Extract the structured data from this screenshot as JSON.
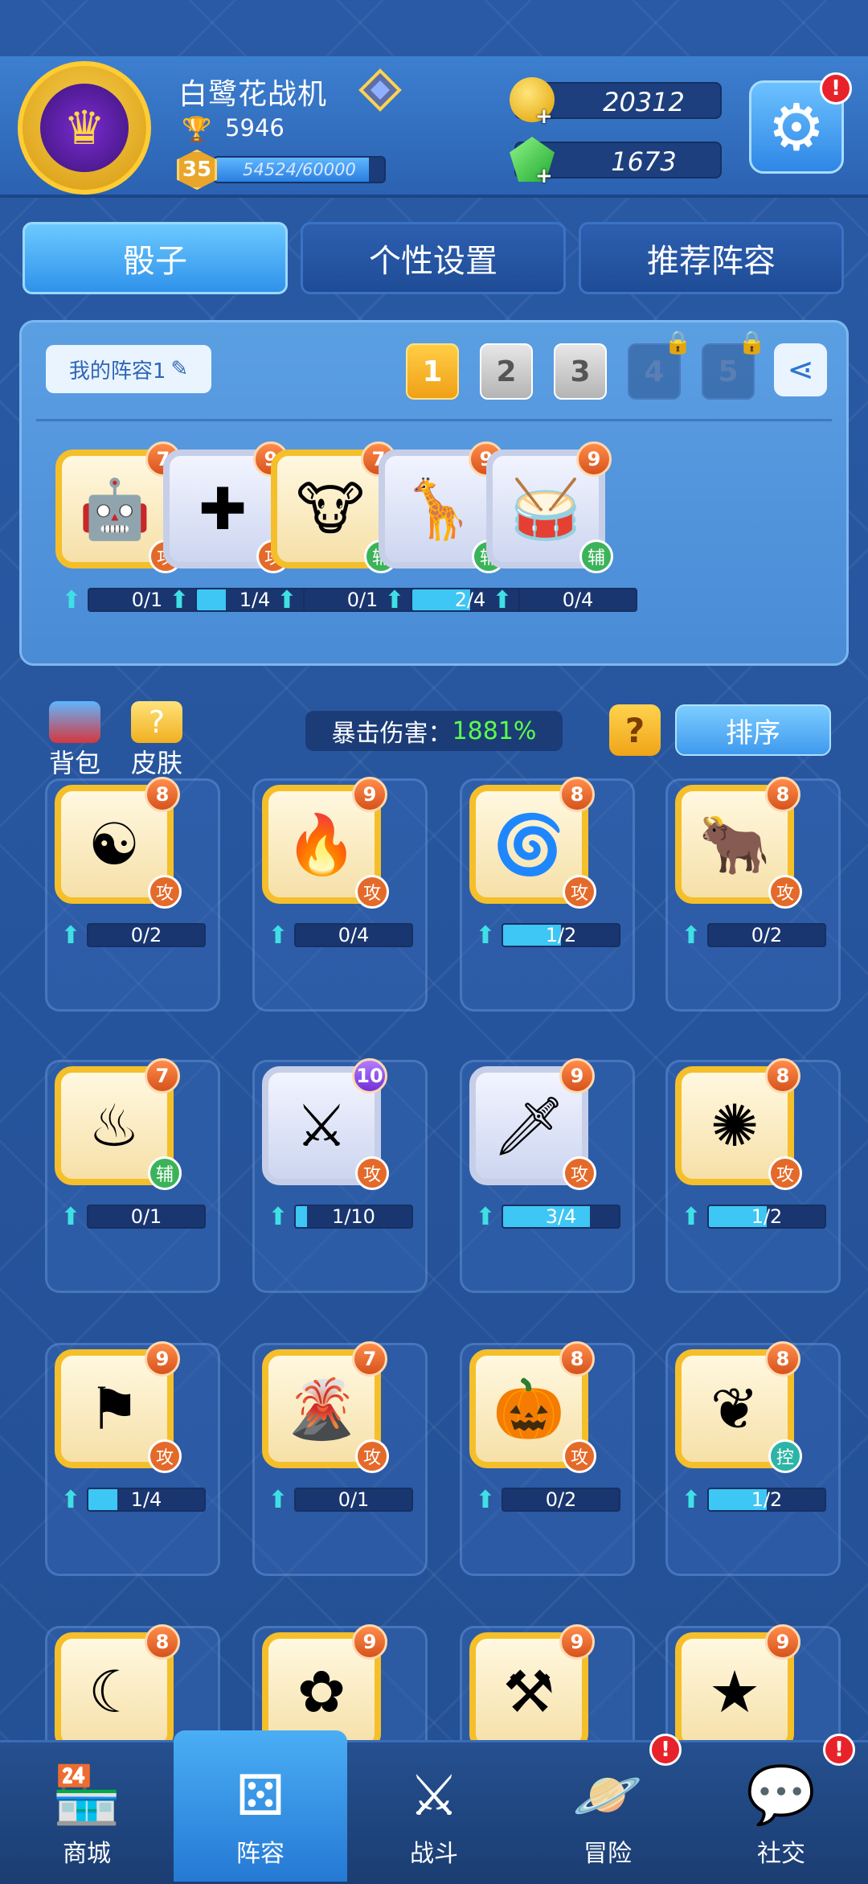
{
  "player": {
    "name": "白鹭花战机",
    "trophies": "5946",
    "level": "35",
    "xp_text": "54524/60000",
    "xp_fraction": 0.9087
  },
  "currency": {
    "gold": "20312",
    "gems": "1673"
  },
  "tabs": [
    "骰子",
    "个性设置",
    "推荐阵容"
  ],
  "lineup": {
    "name": "我的阵容1",
    "slots": [
      "1",
      "2",
      "3",
      "4",
      "5"
    ],
    "selected_slot": "1",
    "locked_slots": [
      "4",
      "5"
    ],
    "dice": [
      {
        "level": "7",
        "role": "攻",
        "progress": "0/1",
        "fraction": 0.0,
        "icon": "robot-icon",
        "frame": "gold"
      },
      {
        "level": "9",
        "role": "攻",
        "progress": "1/4",
        "fraction": 0.25,
        "icon": "holy-cross-icon",
        "frame": "silver"
      },
      {
        "level": "7",
        "role": "辅",
        "progress": "0/1",
        "fraction": 0.0,
        "icon": "bull-face-icon",
        "frame": "gold"
      },
      {
        "level": "9",
        "role": "辅",
        "progress": "2/4",
        "fraction": 0.5,
        "icon": "giraffe-icon",
        "frame": "silver"
      },
      {
        "level": "9",
        "role": "辅",
        "progress": "0/4",
        "fraction": 0.0,
        "icon": "red-drum-icon",
        "frame": "silver"
      }
    ]
  },
  "mid": {
    "bag_label": "背包",
    "skin_label": "皮肤",
    "crit_label": "暴击伤害：",
    "crit_value": "1881%",
    "help_label": "?",
    "sort_label": "排序"
  },
  "collection": [
    {
      "level": "8",
      "role": "攻",
      "progress": "0/2",
      "fraction": 0.0,
      "icon": "yin-yang-icon",
      "glyph": "☯",
      "frame": "gold"
    },
    {
      "level": "9",
      "role": "攻",
      "progress": "0/4",
      "fraction": 0.0,
      "icon": "fire-icon",
      "glyph": "🔥",
      "frame": "gold"
    },
    {
      "level": "8",
      "role": "攻",
      "progress": "1/2",
      "fraction": 0.5,
      "icon": "whirlpool-icon",
      "glyph": "🌀",
      "frame": "gold"
    },
    {
      "level": "8",
      "role": "攻",
      "progress": "0/2",
      "fraction": 0.0,
      "icon": "bull-icon",
      "glyph": "🐂",
      "frame": "gold"
    },
    {
      "level": "7",
      "role": "辅",
      "progress": "0/1",
      "fraction": 0.0,
      "icon": "altar-icon",
      "glyph": "♨",
      "frame": "gold"
    },
    {
      "level": "10",
      "role": "攻",
      "progress": "1/10",
      "fraction": 0.1,
      "icon": "sword-burst-icon",
      "glyph": "⚔",
      "frame": "silver"
    },
    {
      "level": "9",
      "role": "攻",
      "progress": "3/4",
      "fraction": 0.75,
      "icon": "ice-sword-icon",
      "glyph": "🗡",
      "frame": "silver"
    },
    {
      "level": "8",
      "role": "攻",
      "progress": "1/2",
      "fraction": 0.5,
      "icon": "galaxy-icon",
      "glyph": "✺",
      "frame": "gold"
    },
    {
      "level": "9",
      "role": "攻",
      "progress": "1/4",
      "fraction": 0.25,
      "icon": "war-banner-icon",
      "glyph": "⚑",
      "frame": "gold"
    },
    {
      "level": "7",
      "role": "攻",
      "progress": "0/1",
      "fraction": 0.0,
      "icon": "volcano-icon",
      "glyph": "🌋",
      "frame": "gold"
    },
    {
      "level": "8",
      "role": "攻",
      "progress": "0/2",
      "fraction": 0.0,
      "icon": "pumpkin-icon",
      "glyph": "🎃",
      "frame": "gold"
    },
    {
      "level": "8",
      "role": "控",
      "progress": "1/2",
      "fraction": 0.5,
      "icon": "angel-wings-icon",
      "glyph": "❦",
      "frame": "gold"
    },
    {
      "level": "8",
      "role": "",
      "progress": "",
      "fraction": 0.0,
      "icon": "moon-lady-icon",
      "glyph": "☾",
      "frame": "gold"
    },
    {
      "level": "9",
      "role": "",
      "progress": "",
      "fraction": 0.0,
      "icon": "cherry-blossom-icon",
      "glyph": "✿",
      "frame": "gold"
    },
    {
      "level": "9",
      "role": "",
      "progress": "",
      "fraction": 0.0,
      "icon": "thunder-hammer-icon",
      "glyph": "⚒",
      "frame": "gold"
    },
    {
      "level": "9",
      "role": "",
      "progress": "",
      "fraction": 0.0,
      "icon": "star-icon",
      "glyph": "★",
      "frame": "gold"
    }
  ],
  "nav": [
    {
      "label": "商城",
      "icon": "shop-icon",
      "glyph": "🏪",
      "alert": false,
      "active": false
    },
    {
      "label": "阵容",
      "icon": "dice-icon",
      "glyph": "⚄",
      "alert": false,
      "active": true
    },
    {
      "label": "战斗",
      "icon": "crossed-swords-icon",
      "glyph": "⚔",
      "alert": false,
      "active": false
    },
    {
      "label": "冒险",
      "icon": "planet-icon",
      "glyph": "🪐",
      "alert": true,
      "active": false
    },
    {
      "label": "社交",
      "icon": "chat-icon",
      "glyph": "💬",
      "alert": true,
      "active": false
    }
  ],
  "alert_mark": "!",
  "colors": {
    "accent": "#3f9aee",
    "gold": "#f4bf2a",
    "crit": "#5cff4a",
    "alert": "#e8222a"
  }
}
